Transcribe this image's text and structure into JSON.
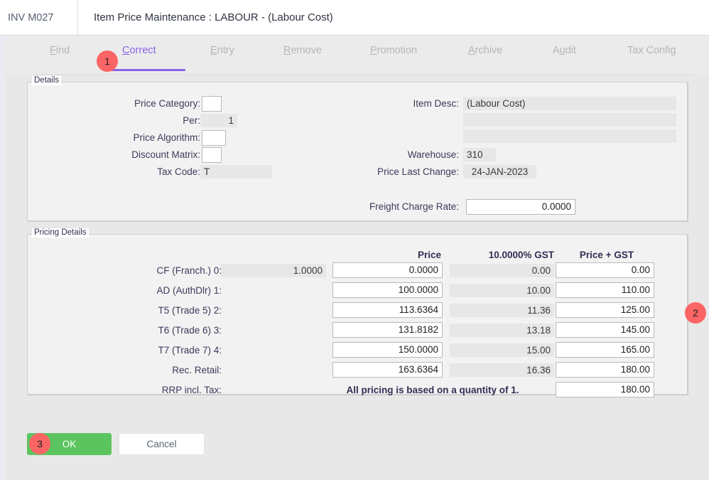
{
  "header": {
    "code": "INV M027",
    "title": "Item Price Maintenance : LABOUR - (Labour Cost)"
  },
  "tabs": [
    {
      "label": "Find",
      "accel": "F",
      "active": false
    },
    {
      "label": "Correct",
      "accel": "C",
      "active": true
    },
    {
      "label": "Entry",
      "accel": "E",
      "active": false
    },
    {
      "label": "Remove",
      "accel": "R",
      "active": false
    },
    {
      "label": "Promotion",
      "accel": "P",
      "active": false
    },
    {
      "label": "Archive",
      "accel": "A",
      "active": false
    },
    {
      "label": "Audit",
      "accel": "u",
      "active": false
    },
    {
      "label": "Tax Config",
      "accel": "",
      "active": false
    }
  ],
  "details": {
    "legend": "Details",
    "left": {
      "price_category_label": "Price Category:",
      "price_category_value": "",
      "per_label": "Per:",
      "per_value": "1",
      "price_algorithm_label": "Price Algorithm:",
      "price_algorithm_value": "",
      "discount_matrix_label": "Discount Matrix:",
      "discount_matrix_value": "",
      "tax_code_label": "Tax Code:",
      "tax_code_value": "T"
    },
    "right": {
      "item_desc_label": "Item Desc:",
      "item_desc_value": "(Labour Cost)",
      "item_desc_line2": "",
      "item_desc_line3": "",
      "warehouse_label": "Warehouse:",
      "warehouse_value": "310",
      "price_last_change_label": "Price Last Change:",
      "price_last_change_value": "24-JAN-2023",
      "freight_charge_rate_label": "Freight Charge Rate:",
      "freight_charge_rate_value": "0.0000"
    }
  },
  "pricing": {
    "legend": "Pricing Details",
    "columns": {
      "price": "Price",
      "gst": "10.0000%  GST",
      "price_plus_gst": "Price + GST"
    },
    "note": "All pricing is based on a quantity of 1.",
    "rows": [
      {
        "label": "CF (Franch.) 0:",
        "factor": "1.0000",
        "price": "0.0000",
        "gst": "0.00",
        "price_gst": "0.00"
      },
      {
        "label": "AD (AuthDlr) 1:",
        "factor": "",
        "price": "100.0000",
        "gst": "10.00",
        "price_gst": "110.00"
      },
      {
        "label": "T5 (Trade 5) 2:",
        "factor": "",
        "price": "113.6364",
        "gst": "11.36",
        "price_gst": "125.00"
      },
      {
        "label": "T6 (Trade 6) 3:",
        "factor": "",
        "price": "131.8182",
        "gst": "13.18",
        "price_gst": "145.00"
      },
      {
        "label": "T7 (Trade 7) 4:",
        "factor": "",
        "price": "150.0000",
        "gst": "15.00",
        "price_gst": "165.00"
      },
      {
        "label": "Rec. Retail:",
        "factor": "",
        "price": "163.6364",
        "gst": "16.36",
        "price_gst": "180.00"
      },
      {
        "label": "RRP incl. Tax:",
        "factor": "",
        "price": "",
        "gst": "",
        "price_gst": "180.00"
      }
    ]
  },
  "footer": {
    "ok_label": "OK",
    "cancel_label": "Cancel"
  },
  "annotations": [
    {
      "id": "1",
      "target": "tab-correct"
    },
    {
      "id": "2",
      "target": "pricing-panel"
    },
    {
      "id": "3",
      "target": "ok-button"
    }
  ],
  "colors": {
    "accent_purple": "#8a63e8",
    "badge_red": "#fc6565",
    "ok_green": "#5cc45f",
    "page_bg": "#e8e8e8"
  }
}
